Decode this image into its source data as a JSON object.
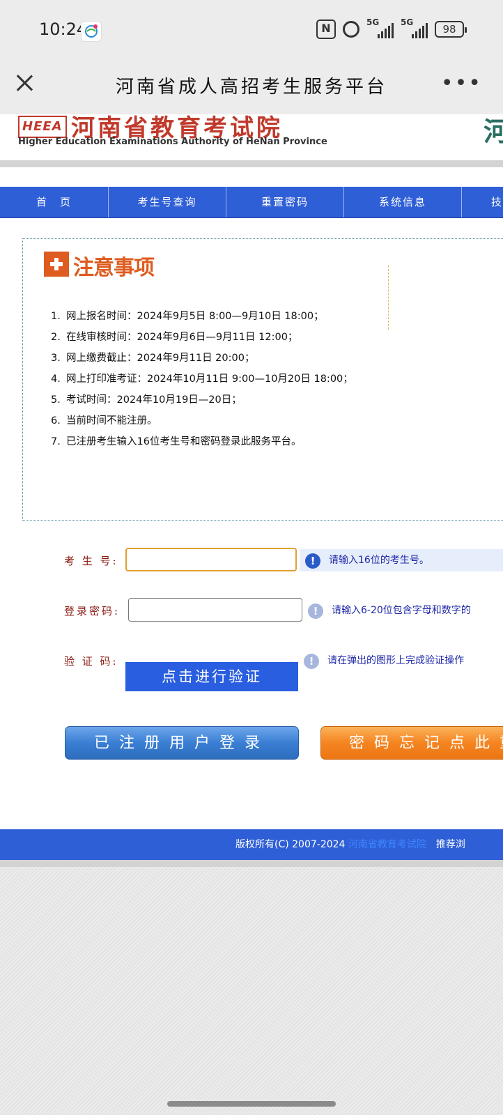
{
  "status_bar": {
    "time": "10:24",
    "network_1": "5G",
    "network_2": "5G",
    "battery": "98",
    "nfc": "N"
  },
  "window": {
    "title": "河南省成人高招考生服务平台"
  },
  "header": {
    "logo_abbr": "HEEA",
    "org_name_cn": "河南省教育考试院",
    "org_name_en": "Higher Education Examinations Authority of HeNan Province",
    "right_logo_char": "河"
  },
  "nav": {
    "items": [
      "首　页",
      "考生号查询",
      "重置密码",
      "系统信息",
      "技"
    ]
  },
  "notice": {
    "title": "注意事项",
    "items": [
      {
        "num": "1.",
        "text": "网上报名时间：2024年9月5日  8:00—9月10日  18:00；"
      },
      {
        "num": "2.",
        "text": "在线审核时间：2024年9月6日—9月11日  12:00；"
      },
      {
        "num": "3.",
        "text": "网上缴费截止：2024年9月11日  20:00；"
      },
      {
        "num": "4.",
        "text": "网上打印准考证：2024年10月11日  9:00—10月20日  18:00；"
      },
      {
        "num": "5.",
        "text": "考试时间：2024年10月19日—20日；"
      },
      {
        "num": "6.",
        "text": "当前时间不能注册。"
      },
      {
        "num": "7.",
        "text": "已注册考生输入16位考生号和密码登录此服务平台。"
      }
    ]
  },
  "form": {
    "exam_id": {
      "label": "考 生 号:",
      "value": "",
      "hint": "请输入16位的考生号。"
    },
    "password": {
      "label": "登录密码:",
      "value": "",
      "hint": "请输入6-20位包含字母和数字的"
    },
    "captcha": {
      "label": "验 证 码:",
      "button": "点击进行验证",
      "hint": "请在弹出的图形上完成验证操作"
    }
  },
  "buttons": {
    "login": "已注册用户登录",
    "forgot": "密码忘记点此重"
  },
  "footer": {
    "copyright": "版权所有(C) 2007-2024 ",
    "link": "河南省教育考试院",
    "recommend": "　推荐浏"
  },
  "colors": {
    "nav_blue": "#2f5fd6",
    "brand_red": "#c0392b",
    "notice_orange": "#de5c1f",
    "hint_blue": "#1f28a8",
    "label_red": "#8a1b12",
    "focus_border": "#e0a030"
  }
}
